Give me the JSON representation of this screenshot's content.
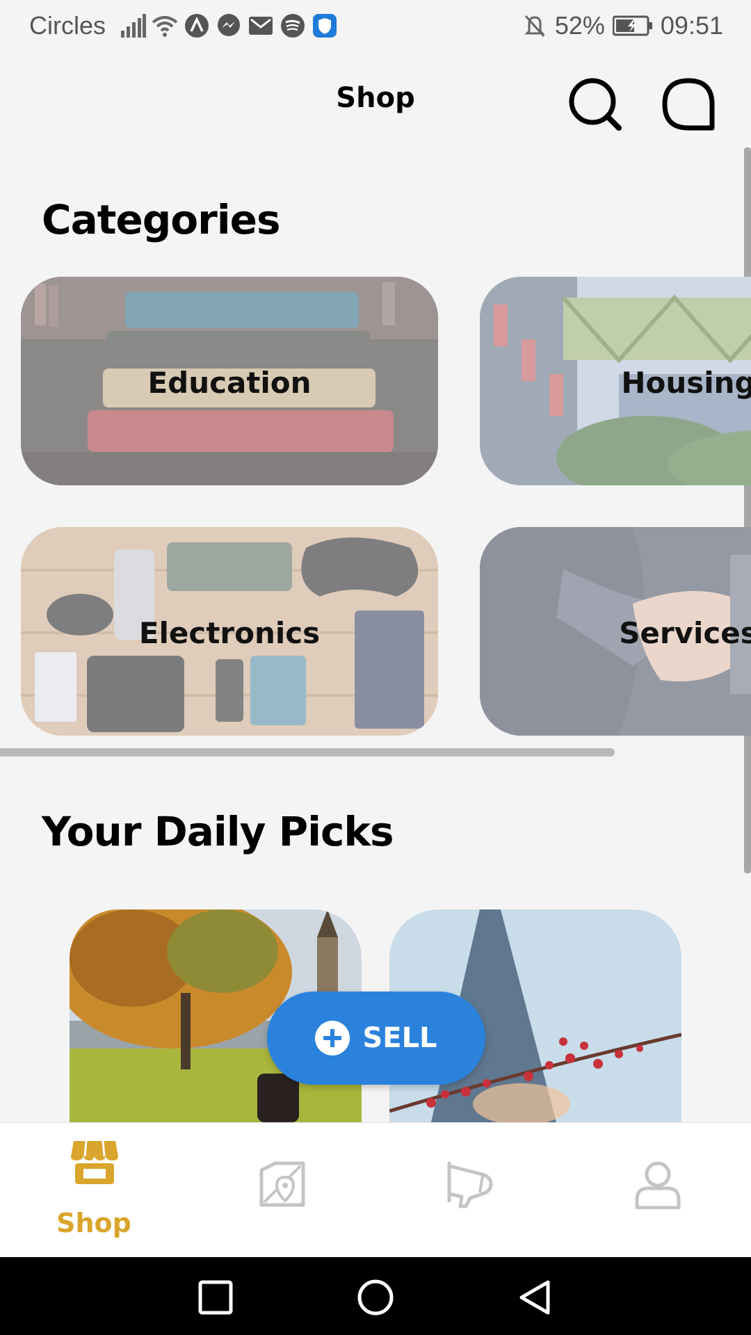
{
  "status_bar": {
    "carrier": "Circles",
    "battery": "52%",
    "time": "09:51",
    "icons": [
      "signal-icon",
      "wifi-icon",
      "app-a-icon",
      "messenger-icon",
      "gmail-icon",
      "spotify-icon",
      "shield-icon",
      "mute-icon",
      "battery-icon"
    ]
  },
  "appbar": {
    "title": "Shop"
  },
  "categories": {
    "heading": "Categories",
    "items": [
      {
        "label": "Education"
      },
      {
        "label": "Housing"
      },
      {
        "label": "Electronics"
      },
      {
        "label": "Services"
      }
    ]
  },
  "daily_picks": {
    "heading": "Your Daily Picks"
  },
  "fab": {
    "label": "SELL"
  },
  "bottom_nav": {
    "items": [
      {
        "label": "Shop",
        "icon": "shop-icon",
        "active": true
      },
      {
        "label": "",
        "icon": "map-icon",
        "active": false
      },
      {
        "label": "",
        "icon": "megaphone-icon",
        "active": false
      },
      {
        "label": "",
        "icon": "profile-icon",
        "active": false
      }
    ]
  },
  "colors": {
    "accent": "#d9a52c",
    "fab": "#2a82dc",
    "inactive_icon": "#c4c4c4"
  }
}
